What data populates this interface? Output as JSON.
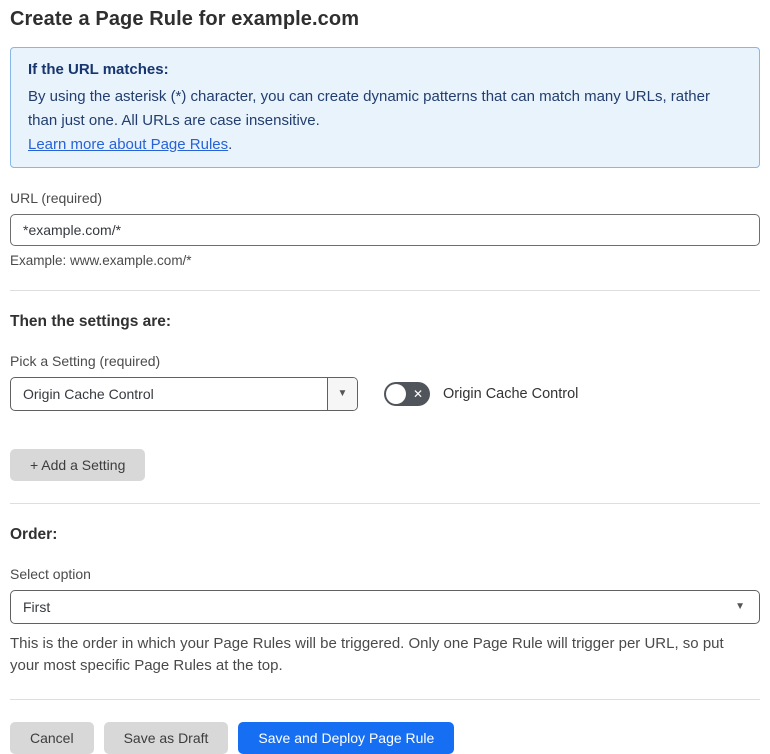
{
  "page": {
    "title": "Create a Page Rule for example.com"
  },
  "info_box": {
    "heading": "If the URL matches:",
    "body": "By using the asterisk (*) character, you can create dynamic patterns that can match many URLs, rather than just one. All URLs are case insensitive.",
    "link_label": "Learn more about Page Rules",
    "link_suffix": "."
  },
  "url_field": {
    "label": "URL (required)",
    "value": "*example.com/*",
    "helper": "Example: www.example.com/*"
  },
  "settings_section": {
    "heading": "Then the settings are:",
    "picker_label": "Pick a Setting (required)",
    "picker_value": "Origin Cache Control",
    "toggle_label": "Origin Cache Control",
    "toggle_state": "off",
    "toggle_off_glyph": "✕",
    "add_setting_label": "+ Add a Setting",
    "caret_glyph": "▼"
  },
  "order_section": {
    "heading": "Order:",
    "select_label": "Select option",
    "select_value": "First",
    "helper": "This is the order in which your Page Rules will be triggered. Only one Page Rule will trigger per URL, so put your most specific Page Rules at the top.",
    "caret_glyph": "▼"
  },
  "actions": {
    "cancel_label": "Cancel",
    "save_draft_label": "Save as Draft",
    "save_deploy_label": "Save and Deploy Page Rule"
  },
  "colors": {
    "accent_blue": "#166FF2",
    "info_bg": "#E9F3FC",
    "info_border": "#86B7E8",
    "info_text": "#223E6E",
    "link_blue": "#2763D6",
    "toggle_off_bg": "#50555B",
    "button_gray": "#D8D8D8"
  }
}
